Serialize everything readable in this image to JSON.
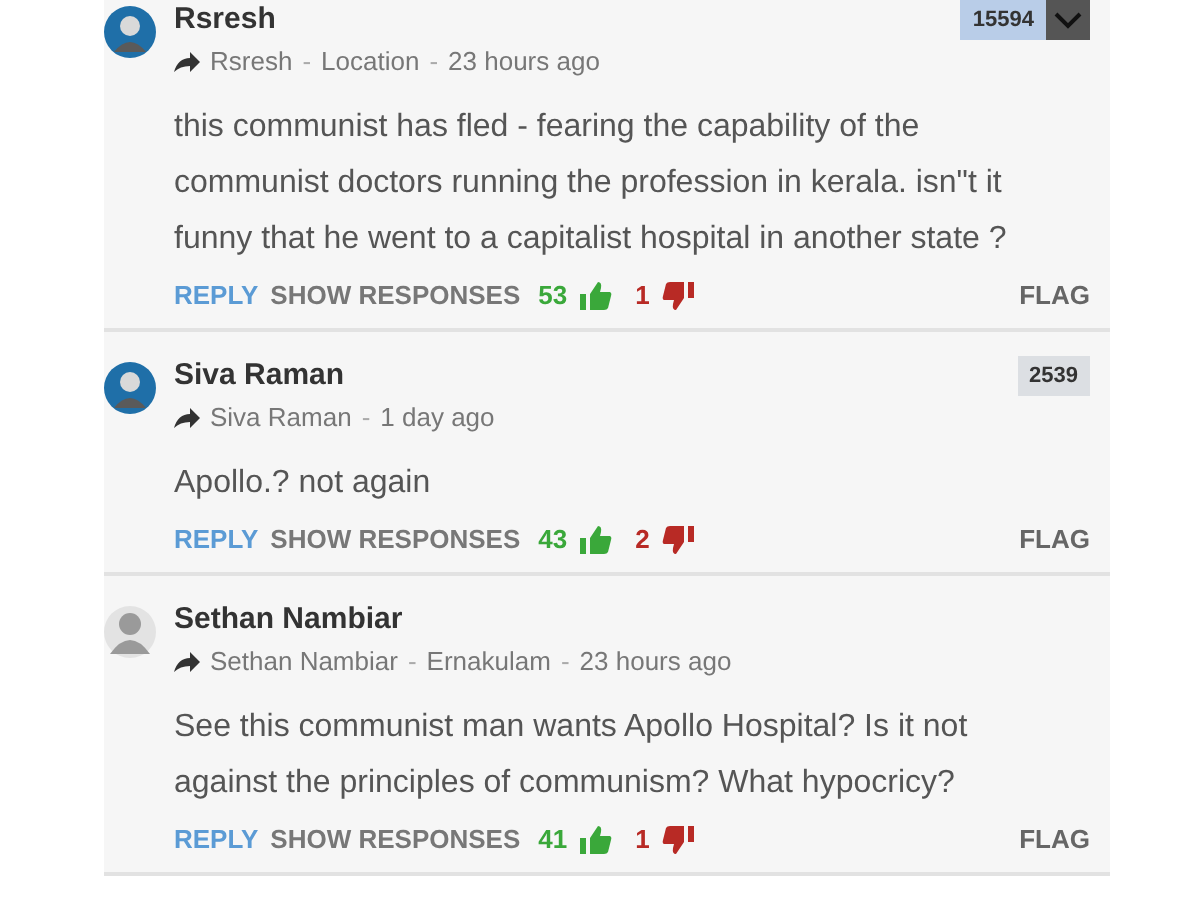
{
  "meta_separator": "-",
  "comments": [
    {
      "author": "Rsresh",
      "avatar": {
        "kind": "circle"
      },
      "badge": {
        "text": "15594",
        "kind": "highlight",
        "menu": true
      },
      "shared_by": "Rsresh",
      "location": "Location",
      "time": "23 hours ago",
      "body": "this communist has fled - fearing the capability of the communist doctors running the profession in kerala. isn\"t it funny that he went to a capitalist hospital in another state ?",
      "reply": "REPLY",
      "show_responses": "SHOW RESPONSES",
      "upvotes": "53",
      "downvotes": "1",
      "flag": "FLAG"
    },
    {
      "author": "Siva Raman",
      "avatar": {
        "kind": "circle"
      },
      "badge": {
        "text": "2539",
        "kind": "plain",
        "menu": false
      },
      "shared_by": "Siva Raman",
      "time": "1 day ago",
      "body": "Apollo.? not again",
      "reply": "REPLY",
      "show_responses": "SHOW RESPONSES",
      "upvotes": "43",
      "downvotes": "2",
      "flag": "FLAG"
    },
    {
      "author": "Sethan Nambiar",
      "avatar": {
        "kind": "silhouette"
      },
      "shared_by": "Sethan Nambiar",
      "location": "Ernakulam",
      "time": "23 hours ago",
      "body": "See this communist man wants Apollo Hospital? Is it not against the principles of communism? What hypocricy?",
      "reply": "REPLY",
      "show_responses": "SHOW RESPONSES",
      "upvotes": "41",
      "downvotes": "1",
      "flag": "FLAG"
    }
  ]
}
